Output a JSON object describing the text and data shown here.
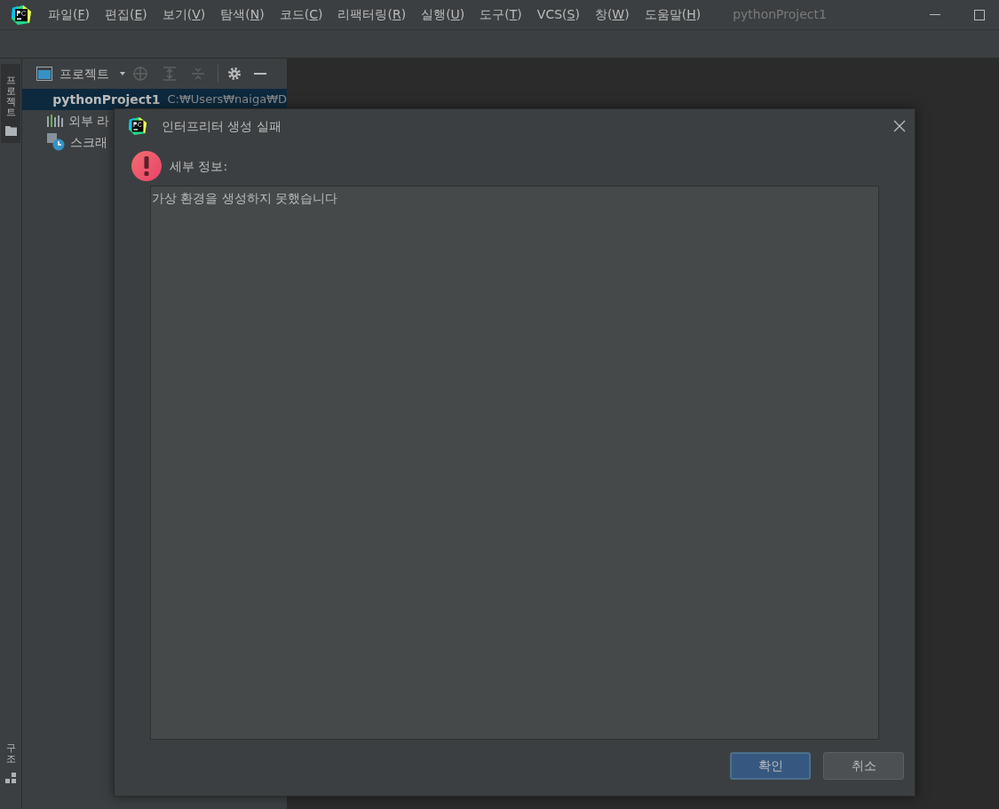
{
  "menu": [
    {
      "before": "파일(",
      "key": "F",
      "after": ")"
    },
    {
      "before": "편집(",
      "key": "E",
      "after": ")"
    },
    {
      "before": "보기(",
      "key": "V",
      "after": ")"
    },
    {
      "before": "탐색(",
      "key": "N",
      "after": ")"
    },
    {
      "before": "코드(",
      "key": "C",
      "after": ")"
    },
    {
      "before": "리팩터링(",
      "key": "R",
      "after": ")"
    },
    {
      "before": "실행(",
      "key": "U",
      "after": ")"
    },
    {
      "before": "도구(",
      "key": "T",
      "after": ")"
    },
    {
      "before": "VCS(",
      "key": "S",
      "after": ")"
    },
    {
      "before": "창(",
      "key": "W",
      "after": ")"
    },
    {
      "before": "도움말(",
      "key": "H",
      "after": ")"
    }
  ],
  "window_title": "pythonProject1",
  "side_tabs_top": [
    {
      "label": "프로젝트",
      "kind": "project"
    }
  ],
  "side_tabs_bottom": [
    {
      "label": "구조",
      "kind": "structure"
    }
  ],
  "project_panel": {
    "title": "프로젝트",
    "items": [
      {
        "label": "pythonProject1",
        "path": "C:₩Users₩naiga₩D",
        "kind": "folder",
        "selected": true
      },
      {
        "label": "외부 라",
        "kind": "library",
        "selected": false
      },
      {
        "label": "스크래",
        "kind": "scratch",
        "selected": false
      }
    ]
  },
  "dialog": {
    "title": "인터프리터 생성 실패",
    "details_label": "세부 정보:",
    "details_text": "가상 환경을 생성하지 못했습니다",
    "buttons": [
      {
        "label": "확인",
        "default": true
      },
      {
        "label": "취소",
        "default": false
      }
    ]
  }
}
